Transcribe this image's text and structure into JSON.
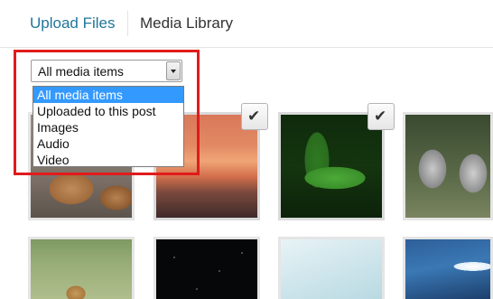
{
  "tabs": {
    "upload": "Upload Files",
    "library": "Media Library"
  },
  "filter": {
    "selected": "All media items",
    "options": [
      "All media items",
      "Uploaded to this post",
      "Images",
      "Audio",
      "Video"
    ]
  },
  "thumbnails": [
    {
      "subject": "lion cubs",
      "selected": false
    },
    {
      "subject": "sunset",
      "selected": true
    },
    {
      "subject": "green leaves",
      "selected": true
    },
    {
      "subject": "lemurs",
      "selected": false
    },
    {
      "subject": "lion in grass",
      "selected": false
    },
    {
      "subject": "starry sky",
      "selected": false
    },
    {
      "subject": "pale blue",
      "selected": false
    },
    {
      "subject": "blue sky",
      "selected": false
    }
  ],
  "check_mark": "✔",
  "colors": {
    "link_blue": "#21759b",
    "selection_blue": "#3399ff",
    "highlight_red": "#e11b1b"
  }
}
